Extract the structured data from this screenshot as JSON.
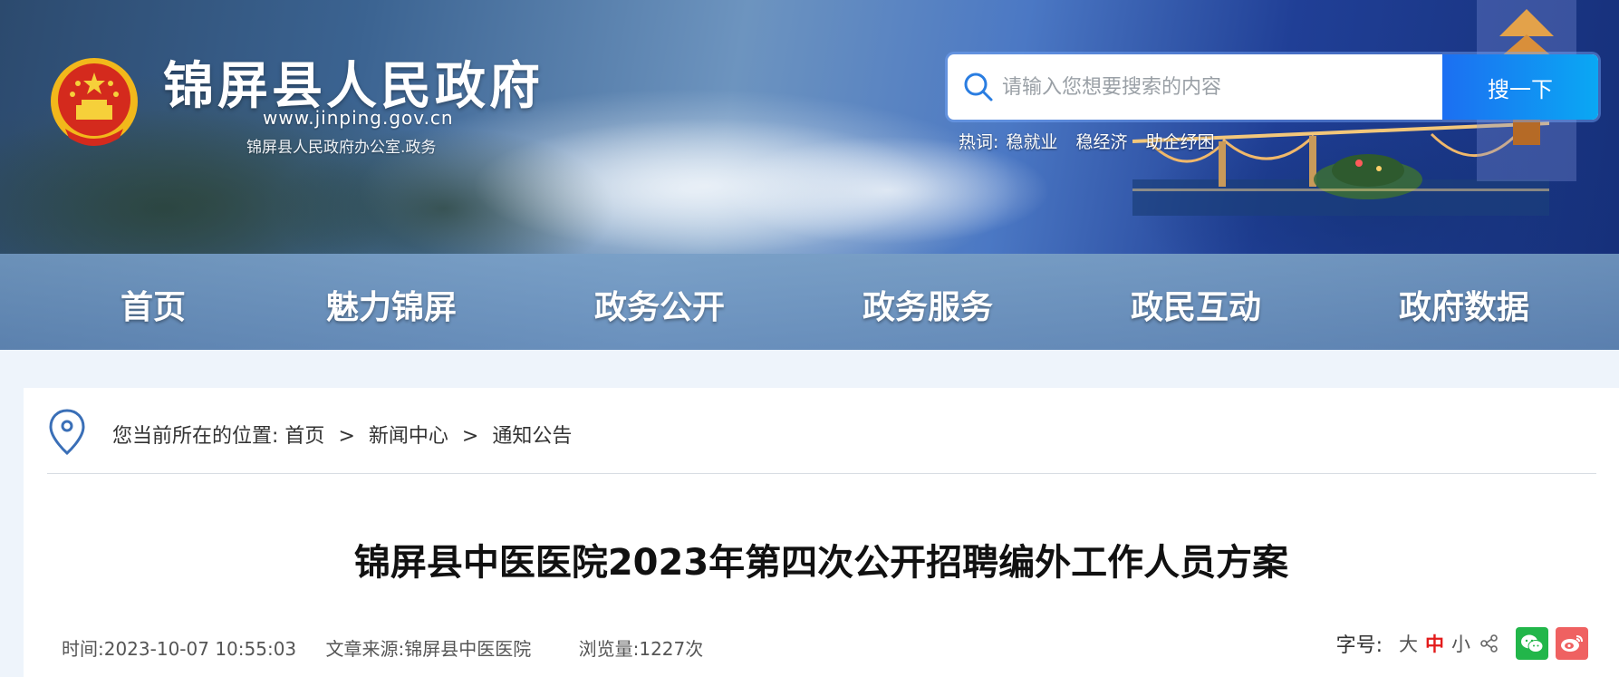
{
  "header": {
    "site_title": "锦屏县人民政府",
    "site_url": "www.jinping.gov.cn",
    "site_subtitle": "锦屏县人民政府办公室.政务",
    "emblem_icon": "national-emblem-icon"
  },
  "search": {
    "placeholder": "请输入您想要搜索的内容",
    "button_label": "搜一下",
    "hotwords_label": "热词:",
    "hotwords": [
      "稳就业",
      "稳经济",
      "助企纾困"
    ]
  },
  "nav": {
    "items": [
      {
        "label": "首页"
      },
      {
        "label": "魅力锦屏"
      },
      {
        "label": "政务公开"
      },
      {
        "label": "政务服务"
      },
      {
        "label": "政民互动"
      },
      {
        "label": "政府数据"
      }
    ]
  },
  "breadcrumb": {
    "prefix": "您当前所在的位置:",
    "items": [
      {
        "label": "首页"
      },
      {
        "label": "新闻中心"
      },
      {
        "label": "通知公告"
      }
    ],
    "separator": ">"
  },
  "article": {
    "title": "锦屏县中医医院2023年第四次公开招聘编外工作人员方案",
    "time": "时间:2023-10-07 10:55:03",
    "source": "文章来源:锦屏县中医医院",
    "views": "浏览量:1227次"
  },
  "tools": {
    "font_label": "字号:",
    "font_large": "大",
    "font_medium": "中",
    "font_small": "小",
    "share_icon": "share-icon",
    "wechat_icon": "wechat-icon",
    "weibo_icon": "weibo-icon"
  },
  "colors": {
    "search_button": "#1c6ff2",
    "active_font_size": "#e31b1b",
    "wechat": "#22b64a",
    "weibo": "#ef6161"
  }
}
